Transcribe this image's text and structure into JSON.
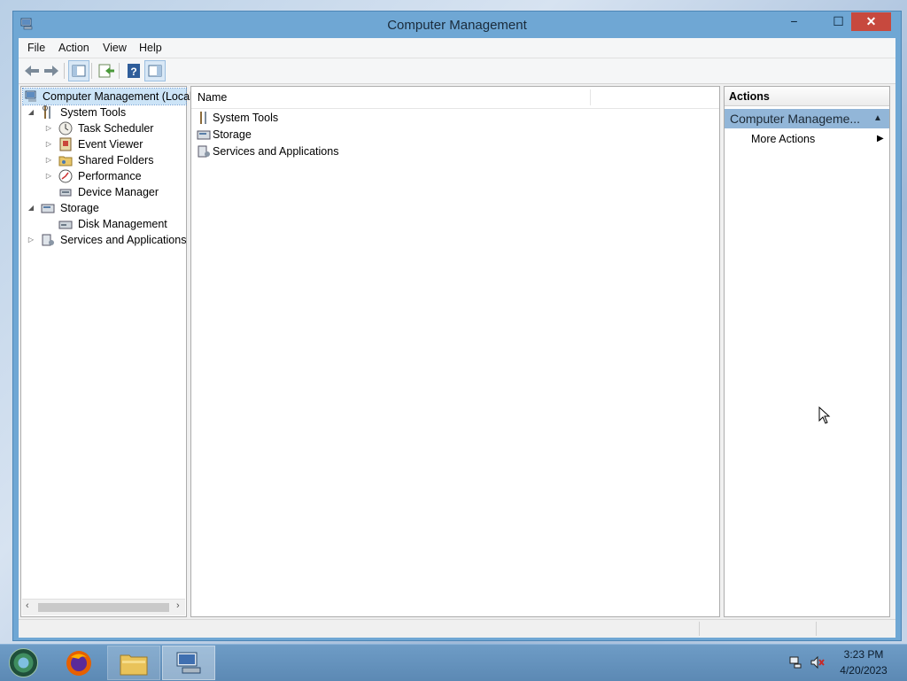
{
  "window": {
    "title": "Computer Management",
    "controls": {
      "minimize": "−",
      "maximize": "☐",
      "close": "✕"
    }
  },
  "menubar": [
    "File",
    "Action",
    "View",
    "Help"
  ],
  "toolbar": [
    "back-icon",
    "forward-icon",
    "show-hide-console-tree-icon",
    "export-list-icon",
    "help-icon",
    "show-hide-action-pane-icon"
  ],
  "tree": {
    "root": "Computer Management (Local",
    "system_tools": "System Tools",
    "task_scheduler": "Task Scheduler",
    "event_viewer": "Event Viewer",
    "shared_folders": "Shared Folders",
    "performance": "Performance",
    "device_manager": "Device Manager",
    "storage": "Storage",
    "disk_management": "Disk Management",
    "services_apps": "Services and Applications"
  },
  "list": {
    "column_name": "Name",
    "items": [
      "System Tools",
      "Storage",
      "Services and Applications"
    ]
  },
  "actions": {
    "header": "Actions",
    "section": "Computer Manageme...",
    "more_actions": "More Actions"
  },
  "taskbar": {
    "time": "3:23 PM",
    "date": "4/20/2023"
  },
  "colors": {
    "title_bar": "#6fa7d4",
    "close_button": "#c7493e",
    "selected_section": "#92b6d8",
    "tree_selection": "#cce4f7"
  }
}
